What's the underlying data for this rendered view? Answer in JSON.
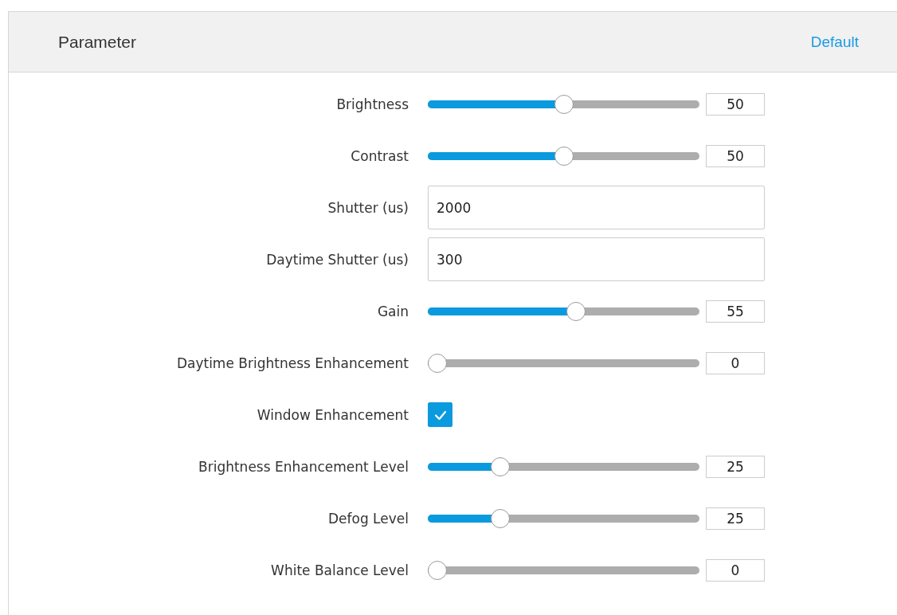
{
  "panel": {
    "title": "Parameter",
    "default_link": "Default"
  },
  "rows": [
    {
      "kind": "slider",
      "label": "Brightness",
      "level": 0.5,
      "value": "50"
    },
    {
      "kind": "slider",
      "label": "Contrast",
      "level": 0.5,
      "value": "50"
    },
    {
      "kind": "field",
      "label": "Shutter (us)",
      "value": "2000"
    },
    {
      "kind": "field",
      "label": "Daytime Shutter (us)",
      "value": "300"
    },
    {
      "kind": "slider",
      "label": "Gain",
      "level": 0.55,
      "value": "55"
    },
    {
      "kind": "slider",
      "label": "Daytime Brightness Enhancement",
      "level": 0,
      "value": "0"
    },
    {
      "kind": "checkbox",
      "label": "Window Enhancement",
      "checked": true
    },
    {
      "kind": "slider",
      "label": "Brightness Enhancement Level",
      "level": 0.25,
      "value": "25"
    },
    {
      "kind": "slider",
      "label": "Defog Level",
      "level": 0.25,
      "value": "25"
    },
    {
      "kind": "slider",
      "label": "White Balance Level",
      "level": 0,
      "value": "0"
    }
  ]
}
